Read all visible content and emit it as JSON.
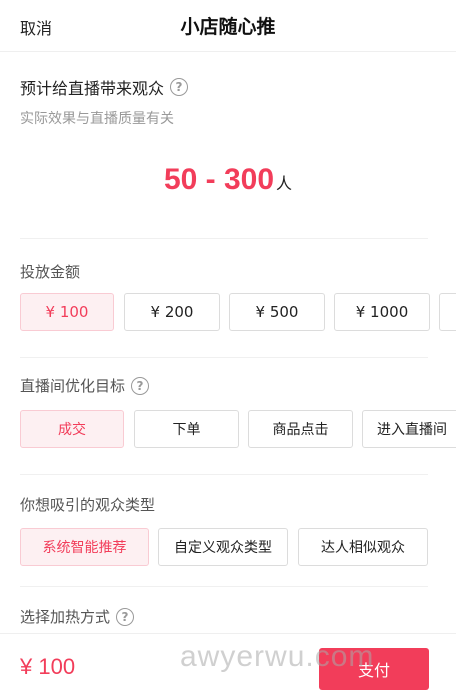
{
  "header": {
    "cancel": "取消",
    "title": "小店随心推"
  },
  "estimate": {
    "title": "预计给直播带来观众",
    "subtitle": "实际效果与直播质量有关",
    "range": "50 - 300",
    "unit": "人"
  },
  "budget": {
    "title": "投放金额",
    "options": [
      "¥ 100",
      "¥ 200",
      "¥ 500",
      "¥ 1000"
    ],
    "selected": "¥ 100"
  },
  "goal": {
    "title": "直播间优化目标",
    "options": [
      "成交",
      "下单",
      "商品点击",
      "进入直播间"
    ],
    "selected": "成交"
  },
  "audience": {
    "title": "你想吸引的观众类型",
    "options": [
      "系统智能推荐",
      "自定义观众类型",
      "达人相似观众"
    ],
    "selected": "系统智能推荐"
  },
  "heating": {
    "title": "选择加热方式"
  },
  "footer": {
    "total": "¥ 100",
    "pay": "支付"
  },
  "watermark": "awyerwu.com",
  "colors": {
    "accent": "#f23d5a",
    "selected_bg": "#fdf0f2"
  },
  "icons": {
    "help": "question-circle-icon"
  }
}
